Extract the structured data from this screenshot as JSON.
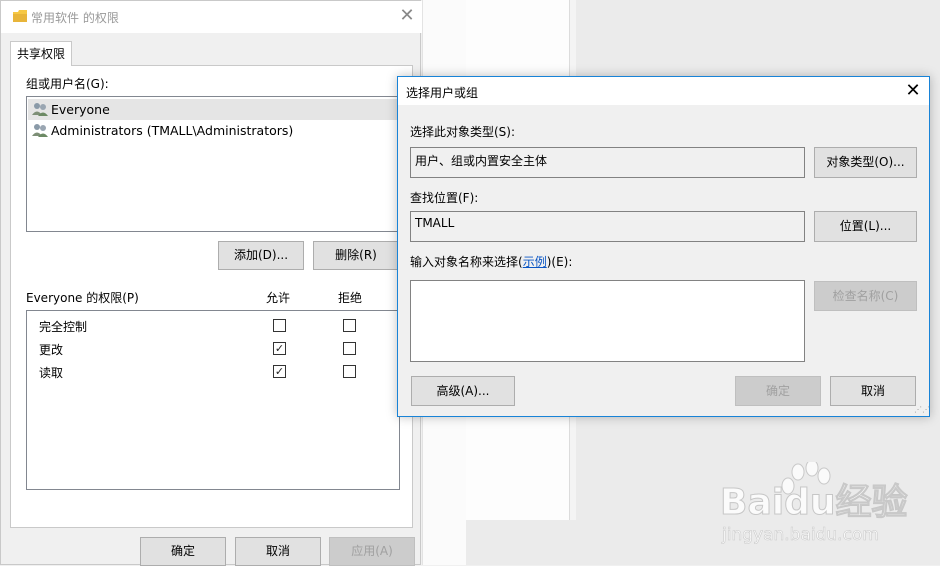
{
  "left_window": {
    "title": "常用软件 的权限",
    "close_glyph": "✕",
    "tab_label": "共享权限",
    "group_label": "组或用户名(G):",
    "users": [
      {
        "name": "Everyone"
      },
      {
        "name": "Administrators (TMALL\\Administrators)"
      }
    ],
    "add_button": "添加(D)...",
    "remove_button": "删除(R)",
    "permissions_label": "Everyone 的权限(P)",
    "allow_header": "允许",
    "deny_header": "拒绝",
    "permissions": [
      {
        "name": "完全控制",
        "allow": false,
        "deny": false
      },
      {
        "name": "更改",
        "allow": true,
        "deny": false
      },
      {
        "name": "读取",
        "allow": true,
        "deny": false
      }
    ],
    "ok_button": "确定",
    "cancel_button": "取消",
    "apply_button": "应用(A)"
  },
  "dialog": {
    "title": "选择用户或组",
    "close_glyph": "✕",
    "object_type_label": "选择此对象类型(S):",
    "object_type_value": "用户、组或内置安全主体",
    "object_type_button": "对象类型(O)...",
    "location_label": "查找位置(F):",
    "location_value": "TMALL",
    "location_button": "位置(L)...",
    "enter_label_prefix": "输入对象名称来选择(",
    "enter_label_link": "示例",
    "enter_label_suffix": ")(E):",
    "names_value": "",
    "check_names_button": "检查名称(C)",
    "advanced_button": "高级(A)...",
    "ok_button": "确定",
    "cancel_button": "取消"
  },
  "watermark": {
    "brand": "Baidu经验",
    "url": "jingyan.baidu.com"
  },
  "colors": {
    "dialog_border": "#1883d7",
    "link": "#0b56c4"
  }
}
